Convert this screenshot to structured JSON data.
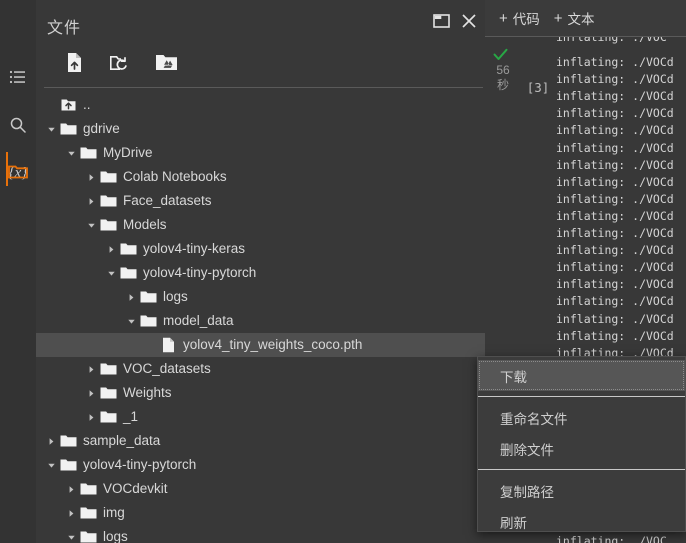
{
  "rail": {
    "items": [
      {
        "name": "table-of-contents",
        "icon": "list-icon",
        "active": false
      },
      {
        "name": "search",
        "icon": "search-icon",
        "active": false
      },
      {
        "name": "variables",
        "icon": "variables-icon",
        "label": "{x}",
        "active": false
      },
      {
        "name": "files",
        "icon": "folder-icon",
        "active": true
      }
    ],
    "active_color": "#e8710a"
  },
  "files_panel": {
    "title": "文件",
    "header_buttons": [
      {
        "name": "open-in-new-window",
        "icon": "popout-window-icon"
      },
      {
        "name": "close-panel",
        "icon": "close-icon"
      }
    ],
    "toolbar": [
      {
        "name": "upload-file",
        "icon": "upload-file-icon"
      },
      {
        "name": "refresh-folder",
        "icon": "refresh-folder-icon"
      },
      {
        "name": "mount-drive",
        "icon": "google-drive-folder-icon"
      }
    ],
    "tree": [
      {
        "label": "..",
        "depth": 0,
        "type": "up",
        "caret": "none",
        "selected": false
      },
      {
        "label": "gdrive",
        "depth": 0,
        "type": "folder",
        "caret": "expanded",
        "selected": false
      },
      {
        "label": "MyDrive",
        "depth": 1,
        "type": "folder",
        "caret": "expanded",
        "selected": false
      },
      {
        "label": "Colab Notebooks",
        "depth": 2,
        "type": "folder",
        "caret": "collapsed",
        "selected": false
      },
      {
        "label": "Face_datasets",
        "depth": 2,
        "type": "folder",
        "caret": "collapsed",
        "selected": false
      },
      {
        "label": "Models",
        "depth": 2,
        "type": "folder",
        "caret": "expanded",
        "selected": false
      },
      {
        "label": "yolov4-tiny-keras",
        "depth": 3,
        "type": "folder",
        "caret": "collapsed",
        "selected": false
      },
      {
        "label": "yolov4-tiny-pytorch",
        "depth": 3,
        "type": "folder",
        "caret": "expanded",
        "selected": false
      },
      {
        "label": "logs",
        "depth": 4,
        "type": "folder",
        "caret": "collapsed",
        "selected": false
      },
      {
        "label": "model_data",
        "depth": 4,
        "type": "folder",
        "caret": "expanded",
        "selected": false
      },
      {
        "label": "yolov4_tiny_weights_coco.pth",
        "depth": 5,
        "type": "file",
        "caret": "none",
        "selected": true
      },
      {
        "label": "VOC_datasets",
        "depth": 2,
        "type": "folder",
        "caret": "collapsed",
        "selected": false
      },
      {
        "label": "Weights",
        "depth": 2,
        "type": "folder",
        "caret": "collapsed",
        "selected": false
      },
      {
        "label": "_1",
        "depth": 2,
        "type": "folder",
        "caret": "collapsed",
        "selected": false
      },
      {
        "label": "sample_data",
        "depth": 0,
        "type": "folder",
        "caret": "collapsed",
        "selected": false
      },
      {
        "label": "yolov4-tiny-pytorch",
        "depth": 0,
        "type": "folder",
        "caret": "expanded",
        "selected": false
      },
      {
        "label": "VOCdevkit",
        "depth": 1,
        "type": "folder",
        "caret": "collapsed",
        "selected": false
      },
      {
        "label": "img",
        "depth": 1,
        "type": "folder",
        "caret": "collapsed",
        "selected": false
      },
      {
        "label": "logs",
        "depth": 1,
        "type": "folder",
        "caret": "expanded",
        "selected": false
      }
    ]
  },
  "notebook": {
    "toolbar": {
      "add_code_label": "代码",
      "add_text_label": "文本",
      "plus": "+"
    },
    "cell": {
      "status_icon": "green-check-icon",
      "status_color": "#2ecc71",
      "elapsed": "56\n秒",
      "elapsed_value": "56",
      "elapsed_unit": "秒",
      "execution_count": "[3]",
      "output_first_line": "inflating: ./VOC",
      "output_lines": [
        "inflating: ./VOCd",
        "inflating: ./VOCd",
        "inflating: ./VOCd",
        "inflating: ./VOCd",
        "inflating: ./VOCd",
        "inflating: ./VOCd",
        "inflating: ./VOCd",
        "inflating: ./VOCd",
        "inflating: ./VOCd",
        "inflating: ./VOCd",
        "inflating: ./VOCd",
        "inflating: ./VOCd",
        "inflating: ./VOCd",
        "inflating: ./VOCd",
        "inflating: ./VOCd",
        "inflating: ./VOCd",
        "inflating: ./VOCd",
        "inflating: ./VOCd",
        "inflating: ./VOCd",
        "inflating: ./VOCd",
        "inflating: ./VOCd",
        "inflating: ./VOCd",
        "inflating: ./VOCd",
        "inflating: ./VOCd",
        "inflating: ./VOCd",
        "inflating: ./VOCd",
        "inflating: ./VOCd",
        "inflating: ./VOCd",
        "inflating: ./VOC"
      ]
    }
  },
  "context_menu": {
    "items": [
      {
        "label": "下载",
        "name": "download",
        "highlight": true
      },
      {
        "label": "重命名文件",
        "name": "rename-file",
        "highlight": false
      },
      {
        "label": "删除文件",
        "name": "delete-file",
        "highlight": false
      },
      {
        "label": "复制路径",
        "name": "copy-path",
        "highlight": false
      },
      {
        "label": "刷新",
        "name": "refresh",
        "highlight": false
      }
    ]
  }
}
